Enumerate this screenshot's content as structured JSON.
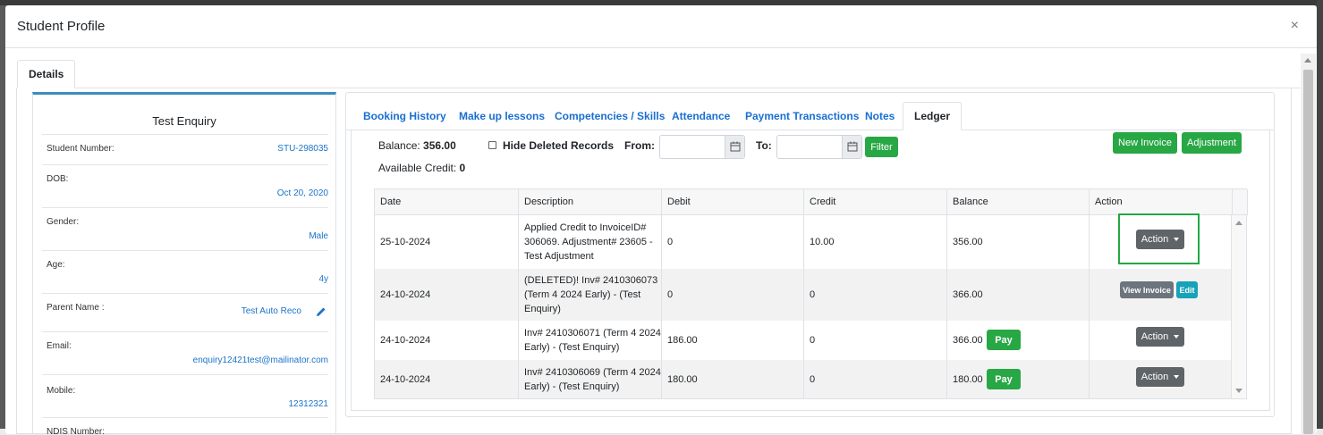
{
  "modal": {
    "title": "Student Profile",
    "close_symbol": "×"
  },
  "outer_tab": {
    "label": "Details"
  },
  "profile": {
    "name": "Test Enquiry",
    "fields": [
      {
        "label": "Student Number:",
        "value": "STU-298035"
      },
      {
        "label": "DOB:",
        "value": "Oct 20, 2020"
      },
      {
        "label": "Gender:",
        "value": "Male"
      },
      {
        "label": "Age:",
        "value": "4y"
      },
      {
        "label": "Parent Name :",
        "value": "Test Auto Reco"
      },
      {
        "label": "Email:",
        "value": "enquiry12421test@mailinator.com"
      },
      {
        "label": "Mobile:",
        "value": "12312321"
      },
      {
        "label": "NDIS Number:",
        "value": ""
      }
    ]
  },
  "tabs": [
    {
      "label": "Booking History"
    },
    {
      "label": "Make up lessons"
    },
    {
      "label": "Competencies / Skills"
    },
    {
      "label": "Attendance"
    },
    {
      "label": "Payment Transactions"
    },
    {
      "label": "Notes"
    },
    {
      "label": "Ledger",
      "active": true
    }
  ],
  "ledger": {
    "balance_label": "Balance:",
    "balance_value": "356.00",
    "available_credit_label": "Available Credit:",
    "available_credit_value": "0",
    "hide_deleted_label": "Hide Deleted Records",
    "hide_deleted_checked": false,
    "from_label": "From:",
    "to_label": "To:",
    "from_value": "",
    "to_value": "",
    "filter_label": "Filter",
    "new_invoice_label": "New Invoice",
    "adjustment_label": "Adjustment",
    "columns": [
      "Date",
      "Description",
      "Debit",
      "Credit",
      "Balance",
      "Action"
    ],
    "rows": [
      {
        "date": "25-10-2024",
        "description": "Applied Credit to InvoiceID# 306069. Adjustment# 23605 - Test Adjustment",
        "debit": "0",
        "credit": "10.00",
        "balance": "356.00",
        "actions": [
          "Action"
        ],
        "pay": false
      },
      {
        "date": "24-10-2024",
        "description": "(DELETED)! Inv# 2410306073 (Term 4 2024 Early) - (Test Enquiry)",
        "debit": "0",
        "credit": "0",
        "balance": "366.00",
        "actions": [
          "View Invoice",
          "Edit"
        ],
        "pay": false
      },
      {
        "date": "24-10-2024",
        "description": "Inv# 2410306071 (Term 4 2024 Early) - (Test Enquiry)",
        "debit": "186.00",
        "credit": "0",
        "balance": "366.00",
        "actions": [
          "Action"
        ],
        "pay": true
      },
      {
        "date": "24-10-2024",
        "description": "Inv# 2410306069 (Term 4 2024 Early) - (Test Enquiry)",
        "debit": "180.00",
        "credit": "0",
        "balance": "180.00",
        "actions": [
          "Action"
        ],
        "pay": true
      }
    ],
    "pay_label": "Pay"
  },
  "colors": {
    "link": "#1a6fd1",
    "success": "#28a745",
    "highlight": "#22a845",
    "card_top": "#3c8dbc"
  }
}
